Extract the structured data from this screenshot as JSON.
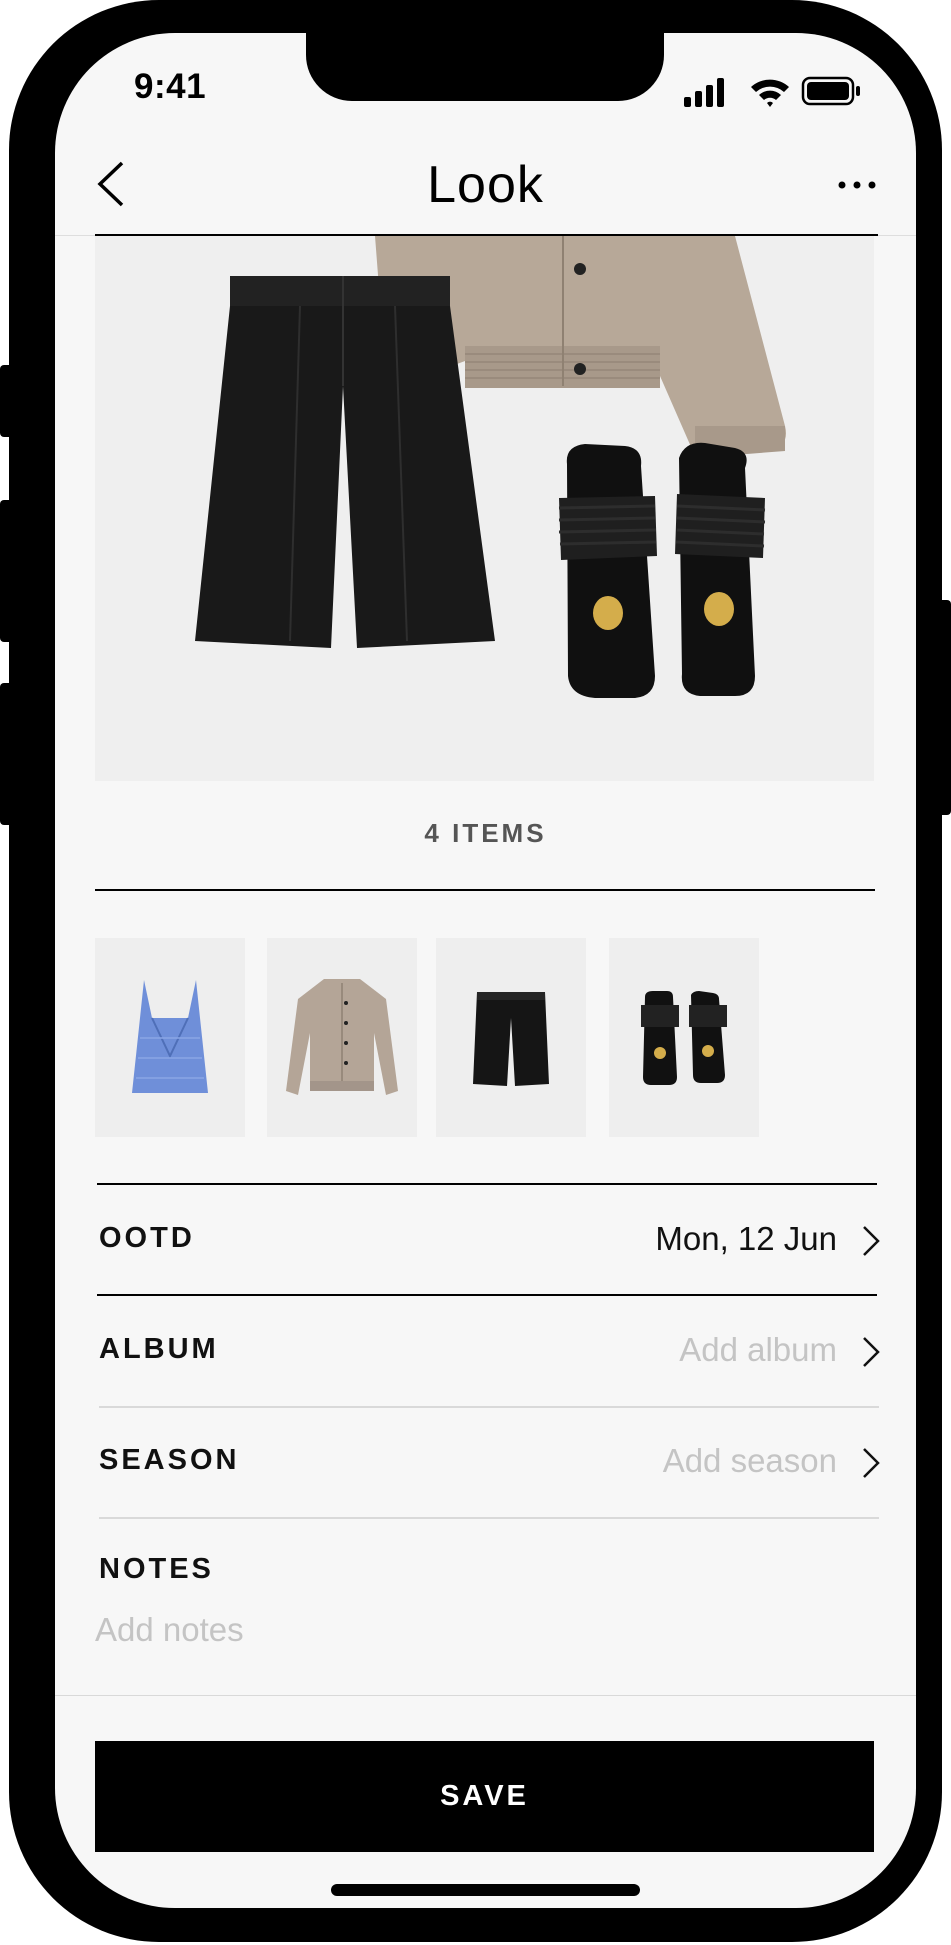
{
  "status_bar": {
    "time": "9:41"
  },
  "nav": {
    "title": "Look",
    "back_icon": "chevron-left-icon",
    "more_icon": "ellipsis-icon"
  },
  "outfit": {
    "items_count_label": "4 ITEMS",
    "items": [
      {
        "name": "blue striped camisole",
        "color": "#6f8fd9"
      },
      {
        "name": "beige bomber jacket",
        "color": "#b4a597"
      },
      {
        "name": "black bermuda shorts",
        "color": "#151515"
      },
      {
        "name": "black woven sandals",
        "color": "#111111"
      }
    ]
  },
  "details": {
    "ootd": {
      "label": "OOTD",
      "value": "Mon, 12 Jun"
    },
    "album": {
      "label": "ALBUM",
      "placeholder": "Add album"
    },
    "season": {
      "label": "SEASON",
      "placeholder": "Add season"
    },
    "notes": {
      "label": "NOTES",
      "placeholder": "Add notes"
    }
  },
  "actions": {
    "save_label": "SAVE"
  },
  "colors": {
    "accent": "#000000",
    "background": "#f7f7f7",
    "placeholder": "#c4c4c4"
  }
}
